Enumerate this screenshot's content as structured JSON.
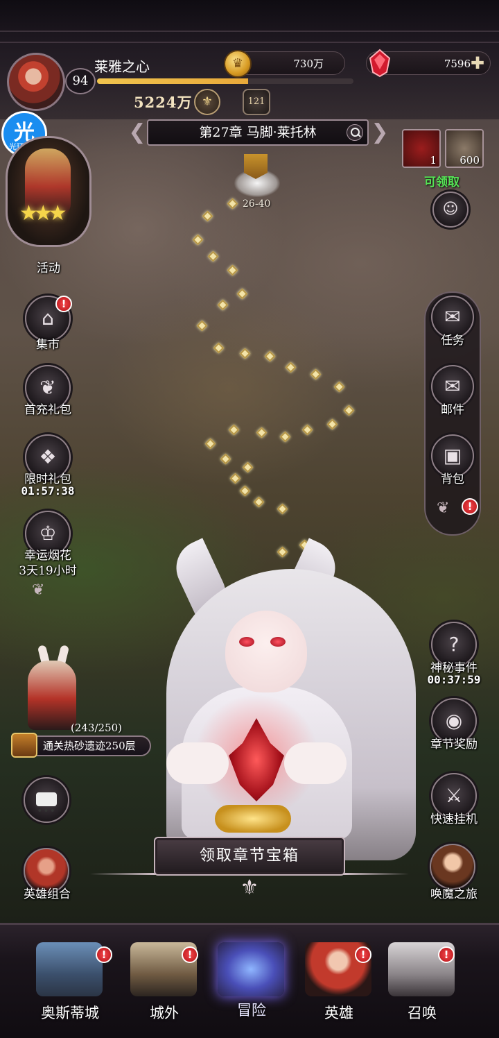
{
  "player": {
    "name": "莱雅之心",
    "level": "94",
    "xp_fraction": 0.59,
    "power": "5224万"
  },
  "resources": {
    "gold": "730万",
    "gems": "7596"
  },
  "rank_badge": "121",
  "chapter": {
    "title": "第27章 马脚·莱托林",
    "stage_range": "26-40"
  },
  "assistant": {
    "glyph": "光",
    "label": "光环助手"
  },
  "left_menu": {
    "event_label": "活动",
    "market_label": "集市",
    "first_recharge_label": "首充礼包",
    "limited_pack_label": "限时礼包",
    "limited_pack_timer": "01:57:38",
    "fireworks_label": "幸运烟花",
    "fireworks_timer": "3天19小时"
  },
  "top_right_rewards": {
    "red_count": "1",
    "v_count": "600",
    "claim_label": "可领取"
  },
  "right_menu": {
    "quest_label": "任务",
    "mail_label": "邮件",
    "bag_label": "背包"
  },
  "right_lower": {
    "mystery_label": "神秘事件",
    "mystery_timer": "00:37:59",
    "chapter_reward_label": "章节奖励",
    "quick_idle_label": "快速挂机",
    "summon_journey_label": "唤魔之旅"
  },
  "quest_tracker": {
    "progress": "(243/250)",
    "text": "通关热砂遗迹250层"
  },
  "hero_combo_label": "英雄组合",
  "claim_button": "领取章节宝箱",
  "alert_glyph": "!",
  "bottom_nav": [
    {
      "label": "奥斯蒂城",
      "alert": true
    },
    {
      "label": "城外",
      "alert": true
    },
    {
      "label": "冒险",
      "alert": false,
      "active": true
    },
    {
      "label": "英雄",
      "alert": true
    },
    {
      "label": "召唤",
      "alert": true
    }
  ],
  "colors": {
    "claimable_green": "#55e355",
    "alert_red": "#e02a2f",
    "gold": "#f0c44e"
  },
  "icons": [
    "search-icon",
    "coin-icon",
    "gem-icon",
    "plus-icon",
    "chat-icon",
    "question-icon",
    "scroll-icon",
    "mail-icon",
    "bag-icon",
    "sword-icon",
    "orb-icon",
    "chest-icon"
  ]
}
